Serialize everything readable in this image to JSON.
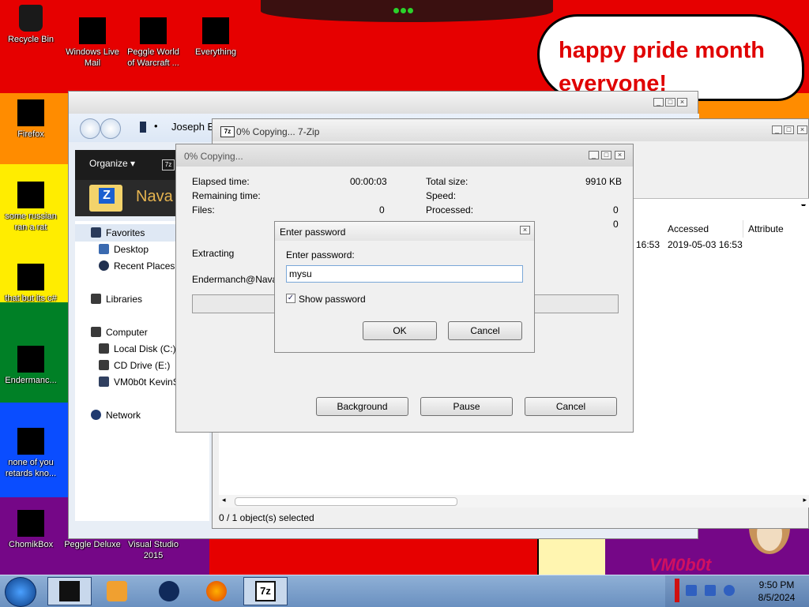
{
  "wallpaper": {
    "bubble_line1": "happy pride month",
    "bubble_line2": "everyone!",
    "corner_text": "VM0b0t"
  },
  "desktop_icons": {
    "recycle_bin": "Recycle Bin",
    "windows_live_mail_1": "Windows Live",
    "windows_live_mail_2": "Mail",
    "peggle_wow_1": "Peggle World",
    "peggle_wow_2": "of Warcraft ...",
    "everything": "Everything",
    "firefox": "Firefox",
    "some_russian_1": "some russian",
    "some_russian_2": "ran a rat",
    "that_but": "that but its c#",
    "endermanch": "Endermanc...",
    "none_of_you_1": "none of you",
    "none_of_you_2": "retards kno...",
    "chomikbox": "ChomikBox",
    "peggle_deluxe": "Peggle Deluxe",
    "visual_studio_1": "Visual Studio",
    "visual_studio_2": "2015"
  },
  "explorer": {
    "breadcrumb": "Joseph E",
    "organize": "Organize",
    "folder_name": "Nava",
    "nav": {
      "favorites": "Favorites",
      "desktop": "Desktop",
      "recent_places": "Recent Places",
      "libraries": "Libraries",
      "computer": "Computer",
      "local_disk": "Local Disk (C:)",
      "cd_drive": "CD Drive (E:)",
      "vm_share": "VM0b0t KevinS",
      "network": "Network"
    }
  },
  "file_manager": {
    "title": "0% Copying... 7-Zip",
    "columns": {
      "accessed": "Accessed",
      "attributes": "Attribute"
    },
    "row": {
      "modified_partial": "16:53",
      "accessed": "2019-05-03 16:53"
    },
    "status": "0 / 1 object(s) selected"
  },
  "copy_dialog": {
    "title": "0% Copying...",
    "elapsed_label": "Elapsed time:",
    "elapsed_value": "00:00:03",
    "remaining_label": "Remaining time:",
    "files_label": "Files:",
    "files_value": "0",
    "total_size_label": "Total size:",
    "total_size_value": "9910 KB",
    "speed_label": "Speed:",
    "processed_label": "Processed:",
    "processed_value": "0",
    "fourth_value": "0",
    "operation": "Extracting",
    "current_file": "Endermanch@NavaSt",
    "progress": 0,
    "background_btn": "Background",
    "pause_btn": "Pause",
    "cancel_btn": "Cancel"
  },
  "password_dialog": {
    "title": "Enter password",
    "prompt": "Enter password:",
    "value": "mysu",
    "show_password_label": "Show password",
    "show_password_checked": true,
    "ok_btn": "OK",
    "cancel_btn": "Cancel"
  },
  "taskbar": {
    "time": "9:50 PM",
    "date": "8/5/2024"
  },
  "colors": {
    "stripe_red": "#e60000",
    "stripe_orange": "#ff8c00",
    "stripe_yellow": "#ffed00",
    "stripe_green": "#008026",
    "stripe_blue": "#0a4dff",
    "stripe_purple": "#750787",
    "bubble_text": "#e00000"
  }
}
